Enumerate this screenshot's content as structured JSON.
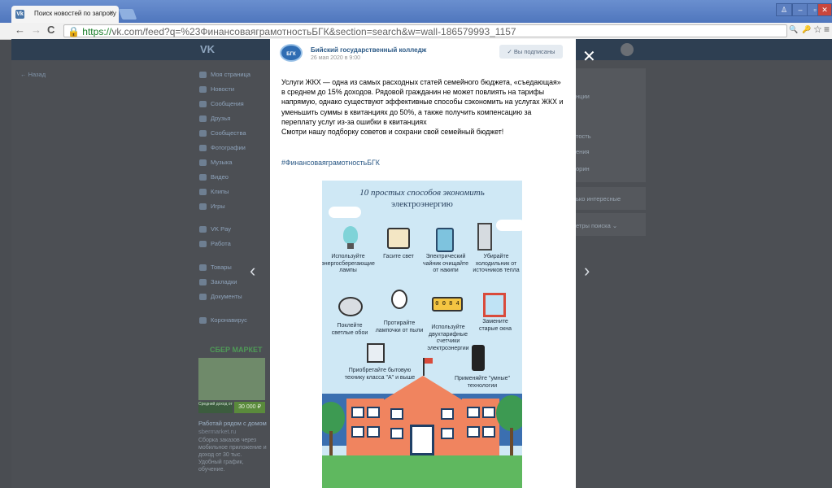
{
  "browser": {
    "tab_title": "Поиск новостей по запросу",
    "tab_favicon": "Vk",
    "tab_close": "×",
    "url_secure": "https://",
    "url_rest": "vk.com/feed?q=%23ФинансоваяграмотностьБГК&section=search&w=wall-186579993_1157",
    "back": "←",
    "forward": "→",
    "reload": "C",
    "win_min": "–",
    "win_max": "▫",
    "win_close": "✕",
    "win_user": "♙",
    "zoom_icon": "🔍",
    "key_icon": "🔑",
    "star_icon": "☆",
    "menu_icon": "≡"
  },
  "vk": {
    "logo": "VK",
    "back_label": "← Назад",
    "left_menu": [
      "Моя страница",
      "Новости",
      "Сообщения",
      "Друзья",
      "Сообщества",
      "Фотографии",
      "Музыка",
      "Видео",
      "Клипы",
      "Игры",
      "VK Pay",
      "Работа",
      "Товары",
      "Закладки",
      "Документы",
      "Коронавирус"
    ],
    "right_items": [
      "нции",
      "тость",
      "ения",
      "орин",
      "ько интересные",
      "етры поиска ⌄"
    ],
    "ad_brand": "СБЕР МАРКЕТ",
    "ad_price": "30 000 ₽",
    "ad_small": "Средний доход от",
    "ad_title": "Работай рядом с домом",
    "ad_site": "sbermarket.ru",
    "ad_text": "Сборка заказов через мобильное приложение и доход от 30 тыс. Удобный график, обучение."
  },
  "post": {
    "author": "Бийский государственный колледж",
    "logo_text": "БГК",
    "date": "26 мая 2020 в 9:00",
    "subscribed": "✓  Вы подписаны",
    "text": "Услуги ЖКХ — одна из самых расходных статей семейного бюджета, «съедающая» в среднем до 15% доходов. Рядовой гражданин не может повлиять на тарифы напрямую, однако существуют эффективные способы сэкономить на услугах ЖКХ и уменьшить суммы в квитанциях до 50%, а также получить компенсацию за переплату услуг из-за ошибки в квитанциях",
    "text2": "Смотри нашу подборку советов и сохрани свой семейный бюджет!",
    "hashtag": "#ФинансоваяграмотностьБГК",
    "prev": "‹",
    "next": "›",
    "close": "✕"
  },
  "infographic": {
    "title1": "10 простых способов экономить",
    "title2": "электроэнергию",
    "tips": [
      "Используйте энергосберегающие лампы",
      "Гасите свет",
      "Электрический чайник очищайте от накипи",
      "Убирайте холодильник от источников тепла",
      "Поклейте светлые обои",
      "Протирайте лампочки от пыли",
      "Используйте двухтарифные счетчики электроэнергии",
      "Замените старые окна",
      "Приобретайте бытовую технику класса \"А\" и выше",
      "Применяйте \"умные\" технологии"
    ],
    "meter_value": "0 0 8 4"
  }
}
